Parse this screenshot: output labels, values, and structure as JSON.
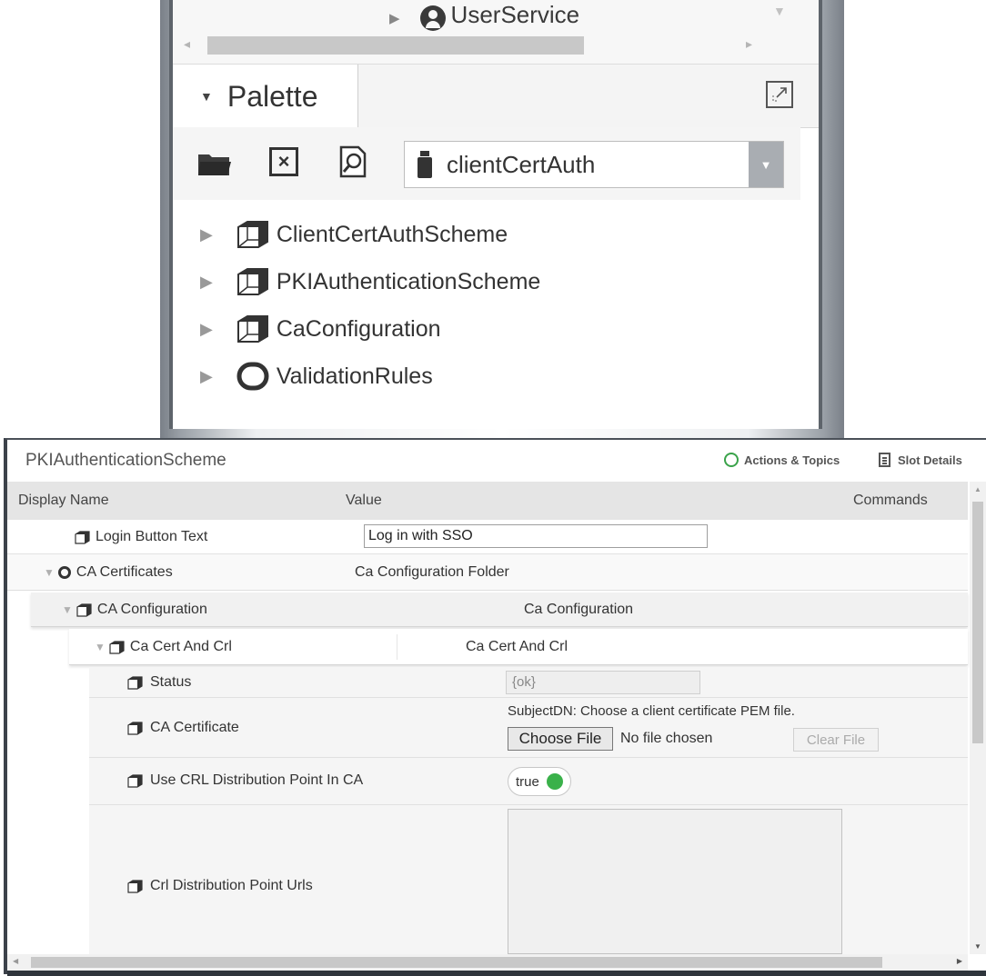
{
  "nav_tree": {
    "partial_item_label": "UserService"
  },
  "palette": {
    "title": "Palette",
    "selected_module": "clientCertAuth",
    "items": [
      {
        "label": "ClientCertAuthScheme",
        "icon": "component-icon"
      },
      {
        "label": "PKIAuthenticationScheme",
        "icon": "component-icon"
      },
      {
        "label": "CaConfiguration",
        "icon": "component-icon"
      },
      {
        "label": "ValidationRules",
        "icon": "folder-ring-icon"
      }
    ]
  },
  "property_sheet": {
    "title": "PKIAuthenticationScheme",
    "actions_topics_label": "Actions & Topics",
    "slot_details_label": "Slot Details",
    "columns": {
      "display_name": "Display Name",
      "value": "Value",
      "commands": "Commands"
    },
    "rows": {
      "login_button_text": {
        "label": "Login Button Text",
        "value": "Log in with SSO"
      },
      "ca_certificates": {
        "label": "CA Certificates",
        "value": "Ca Configuration Folder"
      },
      "ca_configuration": {
        "label": "CA Configuration",
        "value": "Ca Configuration"
      },
      "ca_cert_and_crl": {
        "label": "Ca Cert And Crl",
        "value": "Ca Cert And Crl"
      },
      "status": {
        "label": "Status",
        "value": "{ok}"
      },
      "ca_certificate": {
        "label": "CA Certificate",
        "subject_dn": "SubjectDN: Choose a client certificate PEM file.",
        "choose_file_label": "Choose File",
        "no_file_text": "No file chosen",
        "clear_file_label": "Clear File"
      },
      "use_crl_distribution_point": {
        "label": "Use CRL Distribution Point In CA",
        "value": "true"
      },
      "crl_distribution_point_urls": {
        "label": "Crl Distribution Point Urls",
        "value": ""
      }
    }
  },
  "colors": {
    "toggle_on": "#3ab14a",
    "actions_ring": "#3aa34a",
    "window_border": "#3c424a"
  }
}
